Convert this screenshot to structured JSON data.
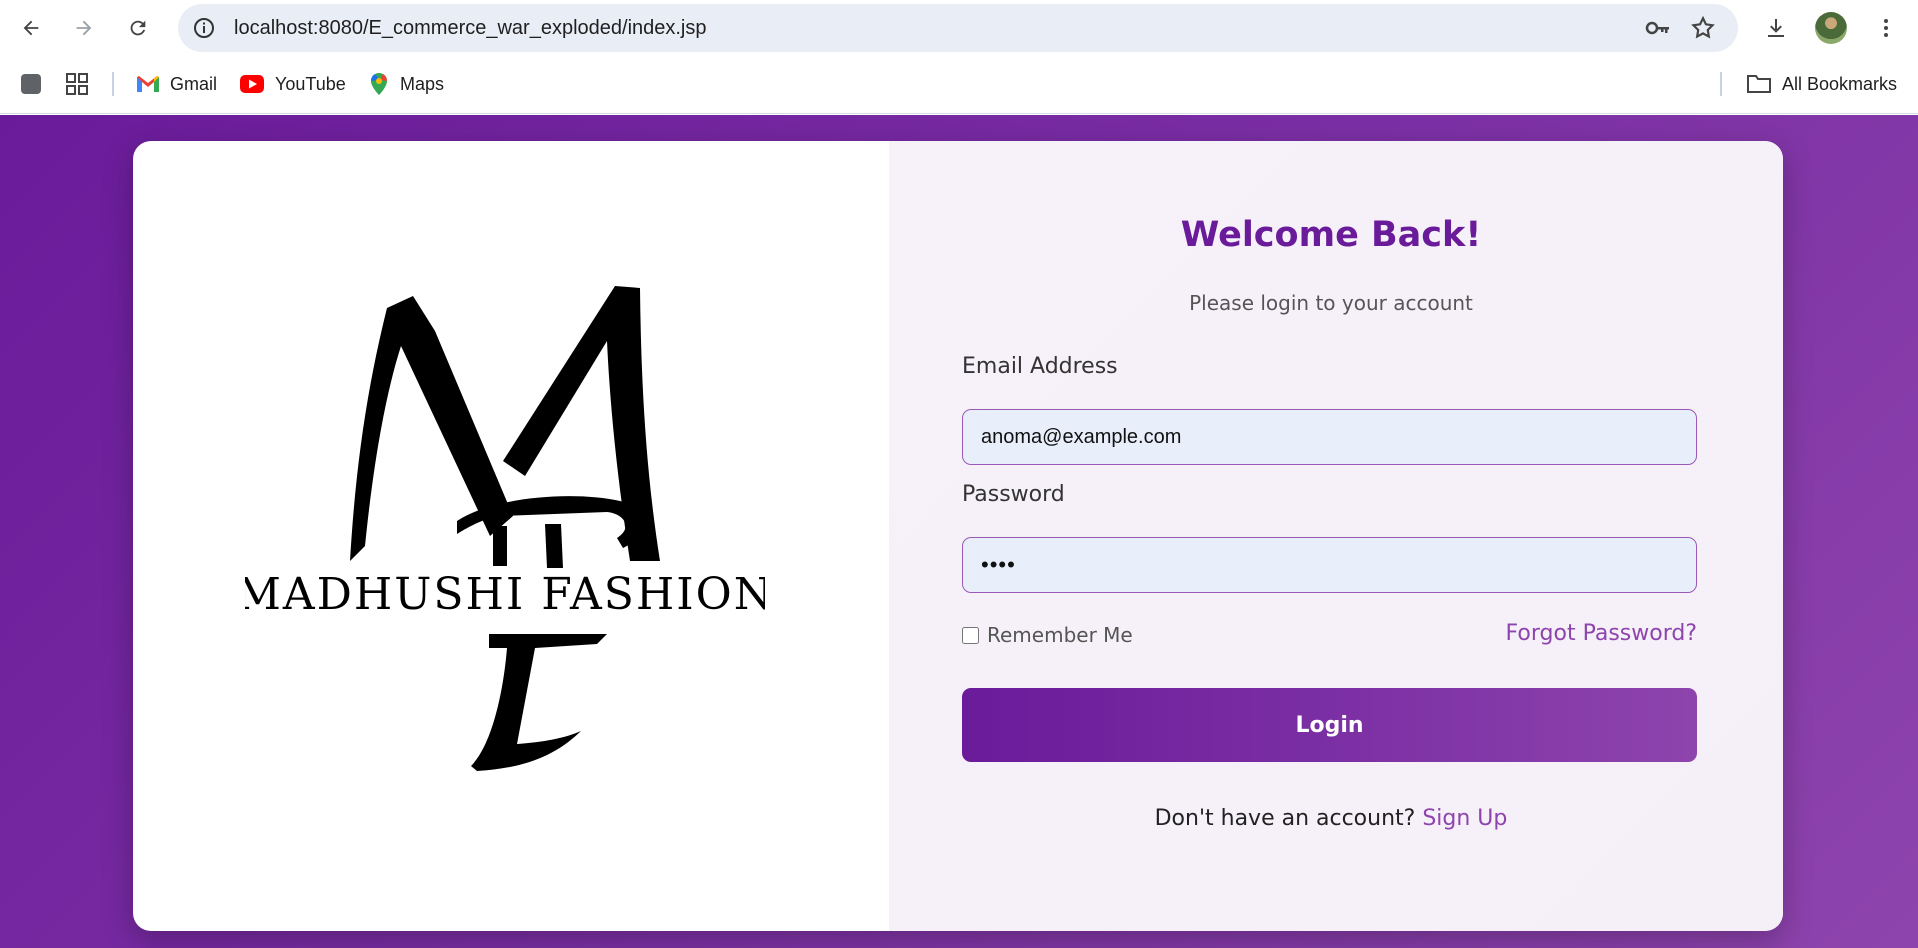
{
  "browser": {
    "url": "localhost:8080/E_commerce_war_exploded/index.jsp",
    "bookmarks": [
      {
        "label": "Gmail",
        "icon": "gmail-icon"
      },
      {
        "label": "YouTube",
        "icon": "youtube-icon"
      },
      {
        "label": "Maps",
        "icon": "maps-icon"
      }
    ],
    "all_bookmarks_label": "All Bookmarks"
  },
  "brand": {
    "name": "MADHUSHI FASHION",
    "monogram": "MF"
  },
  "login": {
    "title": "Welcome Back!",
    "subtitle": "Please login to your account",
    "email_label": "Email Address",
    "email_value": "anoma@example.com",
    "password_label": "Password",
    "password_value": "••••",
    "remember_label": "Remember Me",
    "forgot_label": "Forgot Password?",
    "button_label": "Login",
    "signup_prompt": "Don't have an account?",
    "signup_link": "Sign Up"
  },
  "colors": {
    "primary": "#6a1b9a",
    "accent": "#8e44ad",
    "input_bg": "#e8effb"
  }
}
